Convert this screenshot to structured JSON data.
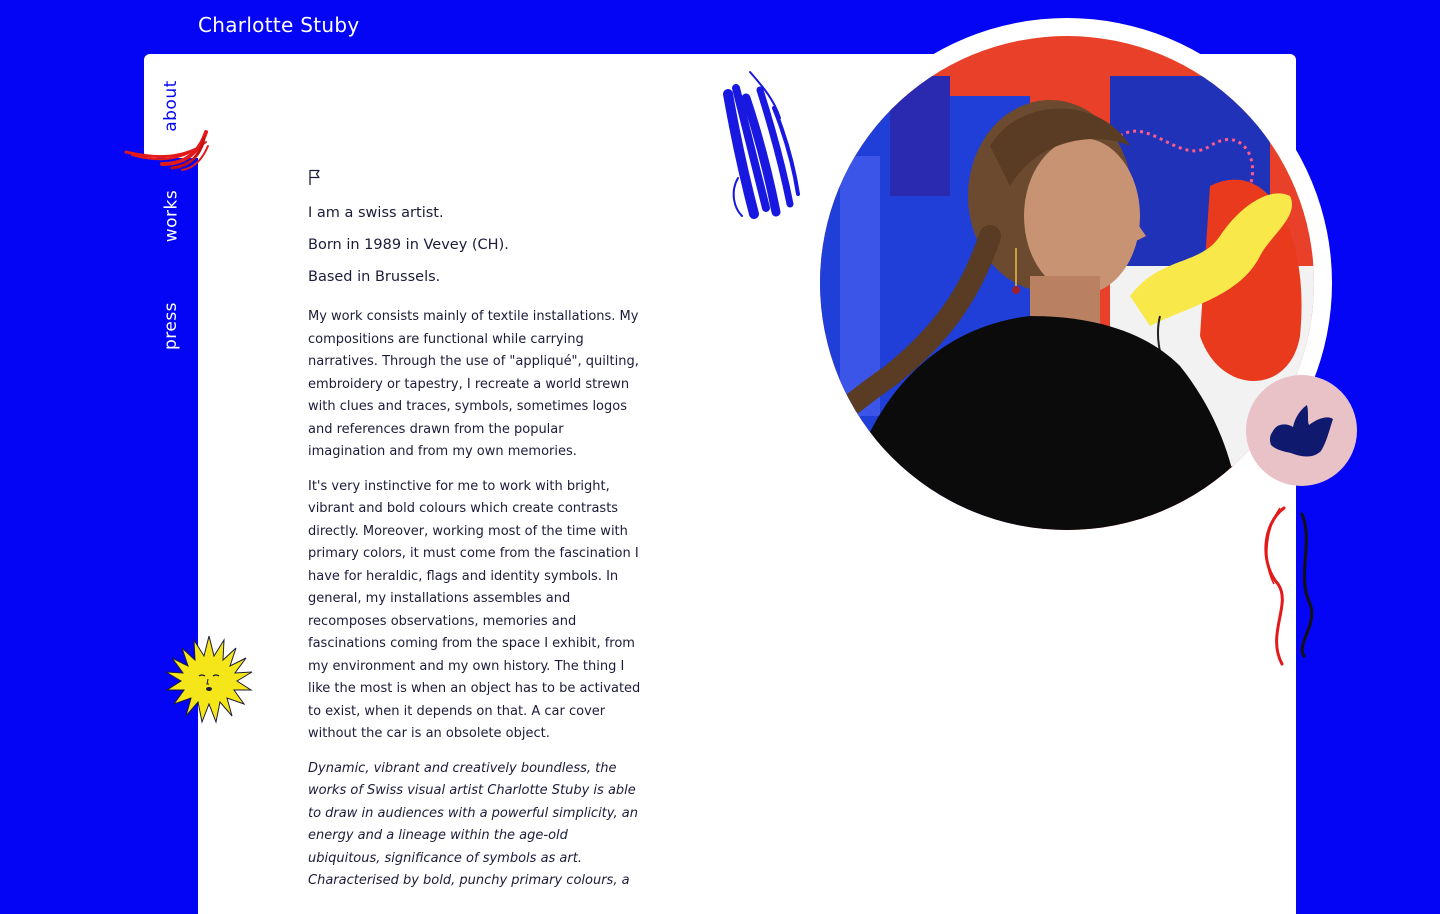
{
  "site": {
    "title": "Charlotte Stuby"
  },
  "nav": {
    "items": [
      {
        "label": "about",
        "active": true
      },
      {
        "label": "works",
        "active": false
      },
      {
        "label": "press",
        "active": false
      }
    ]
  },
  "about": {
    "flag_icon": "flag-icon",
    "intro": [
      "I am a swiss artist.",
      "Born in 1989 in Vevey (CH).",
      "Based in Brussels."
    ],
    "paragraphs": [
      "My work consists mainly of textile installations. My compositions are functional while carrying narratives. Through the use of \"appliqué\", quilting, embroidery or tapestry, I recreate a world strewn with clues and traces, symbols, sometimes logos and references drawn from the popular imagination and from my own memories.",
      "It's very instinctive for me to work with bright, vibrant and bold colours which create contrasts directly. Moreover, working most of the time with primary colors, it must come from the fascination I have for heraldic, flags and identity symbols. In general, my installations assembles and recomposes observations, memories and fascinations coming from the space I exhibit, from my environment and my own history. The thing I like the most is when an object has to be activated to exist, when it depends on that. A car cover without the car is an obsolete object."
    ],
    "quote": [
      "Dynamic, vibrant and creatively boundless, the works of Swiss visual artist Charlotte Stuby is able to draw in audiences with a powerful simplicity, an energy and a lineage within the age-old ubiquitous, significance of symbols as art.",
      "Characterised by bold, punchy primary colours, a"
    ]
  },
  "decorations": {
    "nav_brush": "red-brush-stroke",
    "top_brush": "blue-brush-stroke",
    "sun": "sun-face-icon",
    "badge_icon": "hand-shape-icon",
    "ribbon": "wavy-ribbon-lines",
    "portrait": "artist-portrait-photo"
  },
  "colors": {
    "background": "#0505f5",
    "panel": "#ffffff",
    "text": "#1c1c3a",
    "accent_red": "#e21a1a",
    "accent_yellow": "#f5e61a",
    "badge": "#e9c2c8",
    "navy": "#0f1a6e"
  }
}
